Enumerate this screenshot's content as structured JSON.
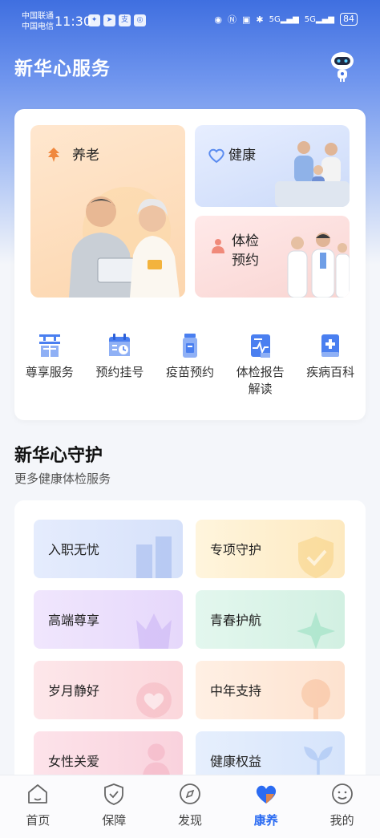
{
  "status_bar": {
    "carrier_1": "中国联通",
    "carrier_2": "中国电信",
    "time": "11:30",
    "signal_1": "5G",
    "signal_2": "5G",
    "battery": "84"
  },
  "header": {
    "title": "新华心服务"
  },
  "tiles": {
    "yanglao": "养老",
    "jiankang": "健康",
    "tijian": "体检\n预约"
  },
  "services": [
    {
      "label": "尊享服务",
      "icon": "crown-service-icon"
    },
    {
      "label": "预约挂号",
      "icon": "calendar-icon"
    },
    {
      "label": "疫苗预约",
      "icon": "vaccine-icon"
    },
    {
      "label": "体检报告\n解读",
      "icon": "medical-report-icon"
    },
    {
      "label": "疾病百科",
      "icon": "medical-book-icon"
    }
  ],
  "guard_section": {
    "title": "新华心守护",
    "subtitle": "更多健康体检服务",
    "items": [
      {
        "label": "入职无忧"
      },
      {
        "label": "专项守护"
      },
      {
        "label": "高端尊享"
      },
      {
        "label": "青春护航"
      },
      {
        "label": "岁月静好"
      },
      {
        "label": "中年支持"
      },
      {
        "label": "女性关爱"
      },
      {
        "label": "健康权益"
      }
    ]
  },
  "bottom_nav": {
    "items": [
      {
        "label": "首页",
        "icon": "home-icon"
      },
      {
        "label": "保障",
        "icon": "shield-icon"
      },
      {
        "label": "发现",
        "icon": "compass-icon"
      },
      {
        "label": "康养",
        "icon": "heart-icon"
      },
      {
        "label": "我的",
        "icon": "user-face-icon"
      }
    ],
    "active": "康养"
  },
  "colors": {
    "accent": "#2b6bf2",
    "header_blue": "#3f6fe0",
    "yanglao_orange": "#f0883e"
  }
}
